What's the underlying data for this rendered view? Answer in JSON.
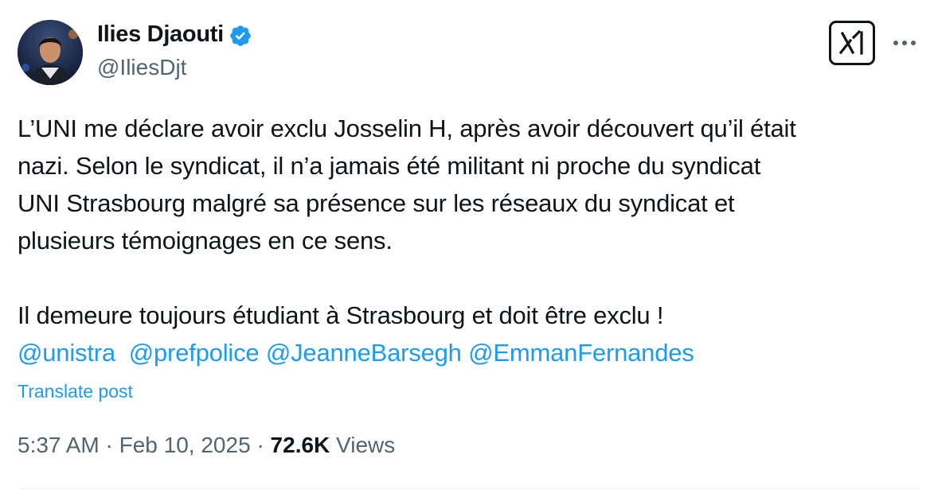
{
  "author": {
    "display_name": "Ilies Djaouti",
    "handle": "@IliesDjt",
    "verified": true,
    "verified_color": "#1d9bf0",
    "avatar_icon": "profile-photo"
  },
  "actions": {
    "grok_icon": "grok-icon",
    "more_icon": "more-dots-icon"
  },
  "post": {
    "paragraph1": [
      "L’UNI me déclare avoir exclu Josselin H, après avoir découvert qu’il était",
      "nazi. Selon le syndicat, il n’a jamais été militant ni proche du syndicat",
      "UNI Strasbourg malgré sa présence sur les réseaux du syndicat et",
      "plusieurs témoignages en ce sens."
    ],
    "paragraph2": "Il demeure toujours étudiant à Strasbourg et doit être exclu !",
    "mentions": [
      "@unistra",
      "@prefpolice",
      "@JeanneBarsegh",
      "@EmmanFernandes"
    ],
    "translate_label": "Translate post",
    "mention_color": "#1d9bf0"
  },
  "meta": {
    "time": "5:37 AM",
    "separator": "·",
    "date": "Feb 10, 2025",
    "views_count": "72.6K",
    "views_label": "Views"
  }
}
